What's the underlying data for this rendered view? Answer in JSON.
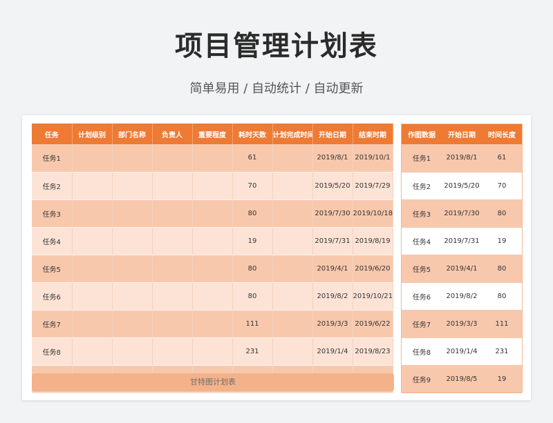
{
  "header": {
    "title": "项目管理计划表",
    "subtitle": "简单易用  /  自动统计  /  自动更新"
  },
  "main_table": {
    "columns": [
      "任务",
      "计划级别",
      "部门名称",
      "负责人",
      "重要程度",
      "耗时天数",
      "计划完成时间",
      "开始日期",
      "结束时期"
    ],
    "rows": [
      [
        "任务1",
        "",
        "",
        "",
        "",
        "61",
        "",
        "2019/8/1",
        "2019/10/1"
      ],
      [
        "任务2",
        "",
        "",
        "",
        "",
        "70",
        "",
        "2019/5/20",
        "2019/7/29"
      ],
      [
        "任务3",
        "",
        "",
        "",
        "",
        "80",
        "",
        "2019/7/30",
        "2019/10/18"
      ],
      [
        "任务4",
        "",
        "",
        "",
        "",
        "19",
        "",
        "2019/7/31",
        "2019/8/19"
      ],
      [
        "任务5",
        "",
        "",
        "",
        "",
        "80",
        "",
        "2019/4/1",
        "2019/6/20"
      ],
      [
        "任务6",
        "",
        "",
        "",
        "",
        "80",
        "",
        "2019/8/2",
        "2019/10/21"
      ],
      [
        "任务7",
        "",
        "",
        "",
        "",
        "111",
        "",
        "2019/3/3",
        "2019/6/22"
      ],
      [
        "任务8",
        "",
        "",
        "",
        "",
        "231",
        "",
        "2019/1/4",
        "2019/8/23"
      ],
      [
        "",
        "",
        "",
        "",
        "",
        "",
        "",
        "",
        ""
      ]
    ]
  },
  "side_table": {
    "columns": [
      "作图数据",
      "开始日期",
      "时间长度"
    ],
    "rows": [
      [
        "任务1",
        "2019/8/1",
        "61"
      ],
      [
        "任务2",
        "2019/5/20",
        "70"
      ],
      [
        "任务3",
        "2019/7/30",
        "80"
      ],
      [
        "任务4",
        "2019/7/31",
        "19"
      ],
      [
        "任务5",
        "2019/4/1",
        "80"
      ],
      [
        "任务6",
        "2019/8/2",
        "80"
      ],
      [
        "任务7",
        "2019/3/3",
        "111"
      ],
      [
        "任务8",
        "2019/1/4",
        "231"
      ],
      [
        "任务9",
        "2019/8/5",
        "19"
      ]
    ]
  },
  "gantt": {
    "label": "甘特图计划表"
  },
  "colors": {
    "header_orange": "#ee7a33",
    "row_dark": "#f8c8ad",
    "row_light": "#fde3d6",
    "gantt_bar": "#f3b289"
  }
}
